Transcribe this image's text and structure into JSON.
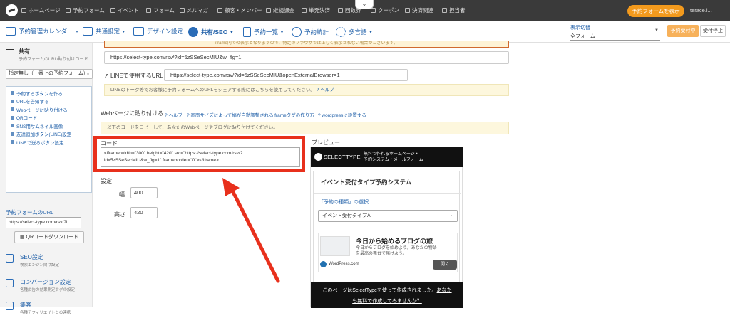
{
  "topbar": {
    "nav": [
      "ホームページ",
      "予約フォーム",
      "イベント",
      "フォーム",
      "メルマガ",
      "顧客・メンバー",
      "継続課金",
      "単発決済",
      "回数券",
      "クーポン",
      "決済関連",
      "担当者"
    ],
    "show_form_button": "予約フォームを表示",
    "user": "terace.l..."
  },
  "secbar": {
    "items": [
      "予約管理カレンダー",
      "共通設定",
      "デザイン設定",
      "共有/SEO",
      "予約一覧",
      "予約統計",
      "多言語"
    ],
    "view_switch_label": "表示切替",
    "view_switch_value": "全フォーム",
    "accepting_button": "予約受付中",
    "stop_button": "受付停止"
  },
  "sidebar": {
    "title": "共有",
    "subtitle": "予約フォームのURL/貼り付けコード",
    "select_value": "指定無し（一番上の予約フォーム）",
    "links": [
      "予約するボタンを作る",
      "URLを告知する",
      "Webページに貼り付ける",
      "QRコード",
      "SNS用サムネイル画像",
      "友達追加ボタン(LINE)設定",
      "LINEで送るボタン設定"
    ],
    "url_label": "予約フォームのURL",
    "url_value": "https://select-type.com/rsv/?i",
    "qr_button": "QRコードダウンロード",
    "items": [
      {
        "title": "SEO設定",
        "desc": "検索エンジン向け設定"
      },
      {
        "title": "コンバージョン設定",
        "desc": "各種広告の効果測定タグの設定"
      },
      {
        "title": "集客",
        "desc": "各種アフィリエイトとの連携"
      }
    ]
  },
  "main": {
    "warning": "iframe内での表示となりますので、特定のブラウザでは正しく表示されない場合がございます。",
    "url1": "https://select-type.com/rsv/?id=5zSSeSecMIU&w_flg=1",
    "line_label": "LINEで使用するURL",
    "line_url": "https://select-type.com/rsv/?id=5zSSeSecMIU&openExternalBrowser=1",
    "line_note": "LINEのトーク等でお客様に予約フォームへのURLをシェアする際にはこちらを使用してください。",
    "line_help": "ヘルプ",
    "embed_label": "Webページに貼り付ける",
    "embed_help1": "ヘルプ",
    "embed_help2": "画面サイズによって幅が自動調整されるiframeタグの作り方",
    "embed_help3": "wordpressに設置する",
    "embed_note": "以下のコードをコピーして、あなたのWebページやブログに貼り付けてください。",
    "code_label": "コード",
    "code_value": "<iframe width=\"300\" height=\"420\" src=\"https://select-type.com/rsv/?id=5zSSeSecMIU&w_flg=1\" frameborder=\"0\"></iframe>",
    "settings_label": "設定",
    "width_label": "幅",
    "width_value": "400",
    "height_label": "高さ",
    "height_value": "420",
    "preview_label": "プレビュー"
  },
  "preview": {
    "brand": "SELECTTYPE",
    "tagline1": "無料で作れるホームページ・",
    "tagline2": "予約システム・メールフォーム",
    "heading": "イベント受付タイプ予約システム",
    "question": "「予約の種類」の選択",
    "select_value": "イベント受付タイプA",
    "ad_title": "今日から始めるブログの旅",
    "ad_text1": "今日からブログを始めよう。あなたの物語",
    "ad_text2": "を最高の舞台で届けよう。",
    "ad_source": "WordPress.com",
    "ad_button": "開く",
    "footer1": "このページはSelectTypeを使って作成されました。",
    "footer1_link": "あなた",
    "footer2": "も無料で作成してみませんか？"
  },
  "colors": {
    "accent": "#1f5fa8",
    "highlight": "#e8301c",
    "orange": "#f39a1d"
  }
}
